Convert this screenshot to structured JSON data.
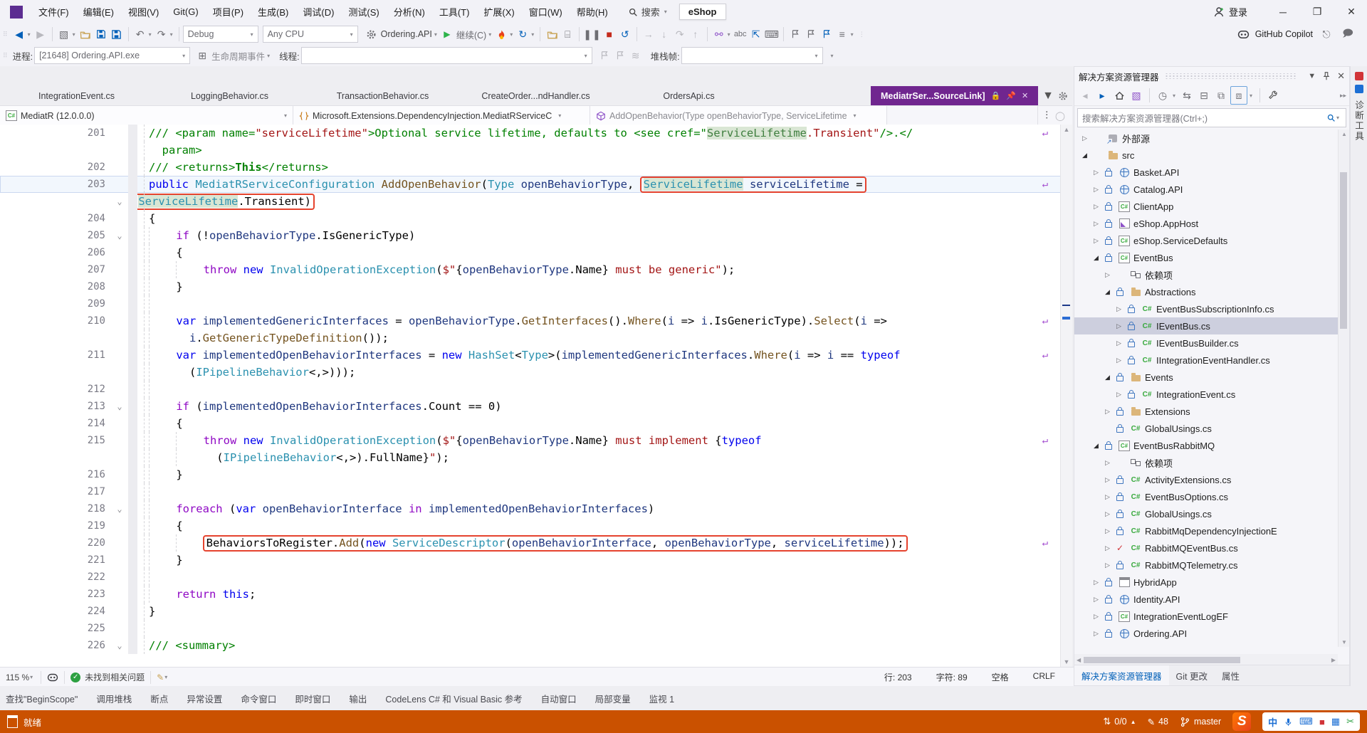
{
  "window": {
    "search_label": "搜索",
    "solution_name": "eShop",
    "sign_in_label": "登录",
    "min_glyph": "─",
    "restore_glyph": "❐",
    "close_glyph": "✕"
  },
  "menu": {
    "items": [
      "文件(F)",
      "编辑(E)",
      "视图(V)",
      "Git(G)",
      "项目(P)",
      "生成(B)",
      "调试(D)",
      "测试(S)",
      "分析(N)",
      "工具(T)",
      "扩展(X)",
      "窗口(W)",
      "帮助(H)"
    ]
  },
  "toolbar": {
    "config_value": "Debug",
    "platform_value": "Any CPU",
    "startup_project": "Ordering.API",
    "continue_label": "继续(C)",
    "copilot_label": "GitHub Copilot"
  },
  "debugbar": {
    "process_label": "进程:",
    "process_value": "[21648] Ordering.API.exe",
    "lifecycle_label": "生命周期事件",
    "thread_label": "线程:",
    "stack_label": "堆栈帧:"
  },
  "tabs": {
    "inactive": [
      "IntegrationEvent.cs",
      "LoggingBehavior.cs",
      "TransactionBehavior.cs",
      "CreateOrder...ndHandler.cs",
      "OrdersApi.cs"
    ],
    "active": "MediatrSer...SourceLink]"
  },
  "breadcrumb": {
    "assembly": "MediatR (12.0.0.0)",
    "type": "Microsoft.Extensions.DependencyInjection.MediatRServiceC",
    "member": "AddOpenBehavior(Type openBehaviorType, ServiceLifetime"
  },
  "editor": {
    "rows": [
      {
        "n": "201",
        "ind": 0,
        "wrap": true,
        "seg": [
          [
            "cm",
            "/// <param name="
          ],
          [
            "s",
            "\"serviceLifetime\""
          ],
          [
            "cm",
            ">Optional service lifetime, defaults to <see cref=\""
          ],
          [
            "hlg",
            "ServiceLifetime"
          ],
          [
            "s",
            ".Transient\""
          ],
          [
            "cm",
            "/>.</"
          ]
        ]
      },
      {
        "n": "",
        "ind": 2,
        "seg": [
          [
            "cm",
            "param>"
          ]
        ]
      },
      {
        "n": "202",
        "ind": 0,
        "seg": [
          [
            "cm",
            "/// <returns>"
          ],
          [
            "cmb",
            "This"
          ],
          [
            "cm",
            "</returns>"
          ]
        ]
      },
      {
        "n": "203",
        "ind": 0,
        "cur": true,
        "wrap": true,
        "seg": [
          [
            "k",
            "public "
          ],
          [
            "t",
            "MediatRServiceConfiguration "
          ],
          [
            "m",
            "AddOpenBehavior"
          ],
          [
            "pl",
            "("
          ],
          [
            "t",
            "Type"
          ],
          [
            "pl",
            " "
          ],
          [
            "p",
            "openBehaviorType"
          ],
          [
            "pl",
            ", "
          ],
          [
            "BOX",
            [
              [
                "hlt",
                "ServiceLifetime"
              ],
              [
                "pl",
                " "
              ],
              [
                "p",
                "serviceLifetime"
              ],
              [
                "pl",
                " ="
              ]
            ]
          ]
        ]
      },
      {
        "n": "",
        "fold": "⌄",
        "ind": -2,
        "seg": [
          [
            "BOX",
            [
              [
                "hlt",
                "ServiceLifetime"
              ],
              [
                "pl",
                ".Transient"
              ],
              [
                "pl",
                ")"
              ]
            ]
          ]
        ]
      },
      {
        "n": "204",
        "ind": 0,
        "seg": [
          [
            "pl",
            "{"
          ]
        ]
      },
      {
        "n": "205",
        "fold": "⌄",
        "ind": 4,
        "seg": [
          [
            "c",
            "if "
          ],
          [
            "pl",
            "(!"
          ],
          [
            "p",
            "openBehaviorType"
          ],
          [
            "pl",
            ".IsGenericType)"
          ]
        ]
      },
      {
        "n": "206",
        "ind": 4,
        "seg": [
          [
            "pl",
            "{"
          ]
        ]
      },
      {
        "n": "207",
        "ind": 8,
        "seg": [
          [
            "c",
            "throw "
          ],
          [
            "k",
            "new "
          ],
          [
            "t",
            "InvalidOperationException"
          ],
          [
            "pl",
            "("
          ],
          [
            "s",
            "$\""
          ],
          [
            "pl",
            "{"
          ],
          [
            "p",
            "openBehaviorType"
          ],
          [
            "pl",
            ".Name}"
          ],
          [
            "s",
            " must be generic\""
          ],
          [
            "pl",
            ");"
          ]
        ]
      },
      {
        "n": "208",
        "ind": 4,
        "seg": [
          [
            "pl",
            "}"
          ]
        ]
      },
      {
        "n": "209",
        "ind": 4,
        "seg": []
      },
      {
        "n": "210",
        "ind": 4,
        "wrap": true,
        "seg": [
          [
            "k",
            "var "
          ],
          [
            "p",
            "implementedGenericInterfaces"
          ],
          [
            "pl",
            " = "
          ],
          [
            "p",
            "openBehaviorType"
          ],
          [
            "pl",
            "."
          ],
          [
            "m",
            "GetInterfaces"
          ],
          [
            "pl",
            "()."
          ],
          [
            "m",
            "Where"
          ],
          [
            "pl",
            "("
          ],
          [
            "p",
            "i"
          ],
          [
            "pl",
            " => "
          ],
          [
            "p",
            "i"
          ],
          [
            "pl",
            ".IsGenericType)."
          ],
          [
            "m",
            "Select"
          ],
          [
            "pl",
            "("
          ],
          [
            "p",
            "i"
          ],
          [
            "pl",
            " =>"
          ]
        ]
      },
      {
        "n": "",
        "ind": 6,
        "seg": [
          [
            "p",
            "i"
          ],
          [
            "pl",
            "."
          ],
          [
            "m",
            "GetGenericTypeDefinition"
          ],
          [
            "pl",
            "());"
          ]
        ]
      },
      {
        "n": "211",
        "ind": 4,
        "wrap": true,
        "seg": [
          [
            "k",
            "var "
          ],
          [
            "p",
            "implementedOpenBehaviorInterfaces"
          ],
          [
            "pl",
            " = "
          ],
          [
            "k",
            "new "
          ],
          [
            "t",
            "HashSet"
          ],
          [
            "pl",
            "<"
          ],
          [
            "t",
            "Type"
          ],
          [
            "pl",
            ">("
          ],
          [
            "p",
            "implementedGenericInterfaces"
          ],
          [
            "pl",
            "."
          ],
          [
            "m",
            "Where"
          ],
          [
            "pl",
            "("
          ],
          [
            "p",
            "i"
          ],
          [
            "pl",
            " => "
          ],
          [
            "p",
            "i"
          ],
          [
            "pl",
            " == "
          ],
          [
            "k",
            "typeof"
          ]
        ]
      },
      {
        "n": "",
        "ind": 6,
        "seg": [
          [
            "pl",
            "("
          ],
          [
            "t",
            "IPipelineBehavior"
          ],
          [
            "pl",
            "<,>)));"
          ]
        ]
      },
      {
        "n": "212",
        "ind": 4,
        "seg": []
      },
      {
        "n": "213",
        "fold": "⌄",
        "ind": 4,
        "seg": [
          [
            "c",
            "if "
          ],
          [
            "pl",
            "("
          ],
          [
            "p",
            "implementedOpenBehaviorInterfaces"
          ],
          [
            "pl",
            ".Count == 0)"
          ]
        ]
      },
      {
        "n": "214",
        "ind": 4,
        "seg": [
          [
            "pl",
            "{"
          ]
        ]
      },
      {
        "n": "215",
        "ind": 8,
        "wrap": true,
        "seg": [
          [
            "c",
            "throw "
          ],
          [
            "k",
            "new "
          ],
          [
            "t",
            "InvalidOperationException"
          ],
          [
            "pl",
            "("
          ],
          [
            "s",
            "$\""
          ],
          [
            "pl",
            "{"
          ],
          [
            "p",
            "openBehaviorType"
          ],
          [
            "pl",
            ".Name}"
          ],
          [
            "s",
            " must implement "
          ],
          [
            "pl",
            "{"
          ],
          [
            "k",
            "typeof"
          ]
        ]
      },
      {
        "n": "",
        "ind": 10,
        "seg": [
          [
            "pl",
            "("
          ],
          [
            "t",
            "IPipelineBehavior"
          ],
          [
            "pl",
            "<,>).FullName}"
          ],
          [
            "s",
            "\""
          ],
          [
            "pl",
            ");"
          ]
        ]
      },
      {
        "n": "216",
        "ind": 4,
        "seg": [
          [
            "pl",
            "}"
          ]
        ]
      },
      {
        "n": "217",
        "ind": 4,
        "seg": []
      },
      {
        "n": "218",
        "fold": "⌄",
        "ind": 4,
        "seg": [
          [
            "c",
            "foreach "
          ],
          [
            "pl",
            "("
          ],
          [
            "k",
            "var "
          ],
          [
            "p",
            "openBehaviorInterface"
          ],
          [
            "pl",
            " "
          ],
          [
            "c",
            "in"
          ],
          [
            "pl",
            " "
          ],
          [
            "p",
            "implementedOpenBehaviorInterfaces"
          ],
          [
            "pl",
            ")"
          ]
        ]
      },
      {
        "n": "219",
        "ind": 4,
        "seg": [
          [
            "pl",
            "{"
          ]
        ]
      },
      {
        "n": "220",
        "ind": 8,
        "wrap": true,
        "seg": [
          [
            "BOX",
            [
              [
                "pl",
                "BehaviorsToRegister."
              ],
              [
                "m",
                "Add"
              ],
              [
                "pl",
                "("
              ],
              [
                "k",
                "new "
              ],
              [
                "t",
                "ServiceDescriptor"
              ],
              [
                "pl",
                "("
              ],
              [
                "p",
                "openBehaviorInterface"
              ],
              [
                "pl",
                ", "
              ],
              [
                "p",
                "openBehaviorType"
              ],
              [
                "pl",
                ", "
              ],
              [
                "p",
                "serviceLifetime"
              ],
              [
                "pl",
                "));"
              ]
            ]
          ]
        ]
      },
      {
        "n": "221",
        "ind": 4,
        "seg": [
          [
            "pl",
            "}"
          ]
        ]
      },
      {
        "n": "222",
        "ind": 4,
        "seg": []
      },
      {
        "n": "223",
        "ind": 4,
        "seg": [
          [
            "c",
            "return "
          ],
          [
            "k",
            "this"
          ],
          [
            "pl",
            ";"
          ]
        ]
      },
      {
        "n": "224",
        "ind": 0,
        "seg": [
          [
            "pl",
            "}"
          ]
        ]
      },
      {
        "n": "225",
        "ind": 0,
        "seg": []
      },
      {
        "n": "226",
        "fold": "⌄",
        "ind": 0,
        "seg": [
          [
            "cm",
            "/// <summary>"
          ]
        ]
      }
    ]
  },
  "edstatus": {
    "zoom": "115 %",
    "health": "未找到相关问题",
    "line": "行: 203",
    "col": "字符: 89",
    "space": "空格",
    "eol": "CRLF"
  },
  "explorer": {
    "title": "解决方案资源管理器",
    "search_placeholder": "搜索解决方案资源管理器(Ctrl+;)",
    "tree": [
      {
        "d": 0,
        "e": "c",
        "i": "ext",
        "t": "外部源"
      },
      {
        "d": 0,
        "e": "e",
        "i": "folder",
        "t": "src"
      },
      {
        "d": 1,
        "e": "c",
        "lk": 1,
        "i": "web",
        "t": "Basket.API"
      },
      {
        "d": 1,
        "e": "c",
        "lk": 1,
        "i": "web",
        "t": "Catalog.API"
      },
      {
        "d": 1,
        "e": "c",
        "lk": 1,
        "i": "csproj",
        "t": "ClientApp"
      },
      {
        "d": 1,
        "e": "c",
        "lk": 1,
        "i": "apph",
        "t": "eShop.AppHost"
      },
      {
        "d": 1,
        "e": "c",
        "lk": 1,
        "i": "csproj",
        "t": "eShop.ServiceDefaults"
      },
      {
        "d": 1,
        "e": "e",
        "lk": 1,
        "i": "csproj",
        "t": "EventBus"
      },
      {
        "d": 2,
        "e": "c",
        "i": "dep",
        "t": "依赖项"
      },
      {
        "d": 2,
        "e": "e",
        "lk": 1,
        "i": "folder",
        "t": "Abstractions"
      },
      {
        "d": 3,
        "e": "c",
        "lk": 1,
        "i": "cs",
        "t": "EventBusSubscriptionInfo.cs"
      },
      {
        "d": 3,
        "e": "c",
        "lk": 1,
        "i": "cs",
        "t": "IEventBus.cs",
        "sel": 1
      },
      {
        "d": 3,
        "e": "c",
        "lk": 1,
        "i": "cs",
        "t": "IEventBusBuilder.cs"
      },
      {
        "d": 3,
        "e": "c",
        "lk": 1,
        "i": "cs",
        "t": "IIntegrationEventHandler.cs"
      },
      {
        "d": 2,
        "e": "e",
        "lk": 1,
        "i": "folder",
        "t": "Events"
      },
      {
        "d": 3,
        "e": "c",
        "lk": 1,
        "i": "cs",
        "t": "IntegrationEvent.cs"
      },
      {
        "d": 2,
        "e": "c",
        "lk": 1,
        "i": "folder",
        "t": "Extensions"
      },
      {
        "d": 2,
        "e": "",
        "lk": 1,
        "i": "cs",
        "t": "GlobalUsings.cs"
      },
      {
        "d": 1,
        "e": "e",
        "lk": 1,
        "i": "csproj",
        "t": "EventBusRabbitMQ"
      },
      {
        "d": 2,
        "e": "c",
        "i": "dep",
        "t": "依赖项"
      },
      {
        "d": 2,
        "e": "c",
        "lk": 1,
        "i": "cs",
        "t": "ActivityExtensions.cs"
      },
      {
        "d": 2,
        "e": "c",
        "lk": 1,
        "i": "cs",
        "t": "EventBusOptions.cs"
      },
      {
        "d": 2,
        "e": "c",
        "lk": 1,
        "i": "cs",
        "t": "GlobalUsings.cs"
      },
      {
        "d": 2,
        "e": "c",
        "lk": 1,
        "i": "cs",
        "t": "RabbitMqDependencyInjectionE"
      },
      {
        "d": 2,
        "e": "c",
        "chk": 1,
        "i": "cs",
        "t": "RabbitMQEventBus.cs"
      },
      {
        "d": 2,
        "e": "c",
        "lk": 1,
        "i": "cs",
        "t": "RabbitMQTelemetry.cs"
      },
      {
        "d": 1,
        "e": "c",
        "lk": 1,
        "i": "win",
        "t": "HybridApp"
      },
      {
        "d": 1,
        "e": "c",
        "lk": 1,
        "i": "web",
        "t": "Identity.API"
      },
      {
        "d": 1,
        "e": "c",
        "lk": 1,
        "i": "csproj",
        "t": "IntegrationEventLogEF"
      },
      {
        "d": 1,
        "e": "c",
        "lk": 1,
        "i": "web",
        "t": "Ordering.API"
      }
    ]
  },
  "panel_tabs": [
    "解决方案资源管理器",
    "Git 更改",
    "属性"
  ],
  "right_strip": {
    "label": "诊断工具"
  },
  "bottom_tabs": [
    "查找\"BeginScope\"",
    "调用堆栈",
    "断点",
    "异常设置",
    "命令窗口",
    "即时窗口",
    "输出",
    "CodeLens C# 和 Visual Basic 参考",
    "自动窗口",
    "局部变量",
    "监视 1"
  ],
  "statusbar": {
    "ready": "就绪",
    "updown": "0/0",
    "pending_edits": "48",
    "branch": "master",
    "sogou": "S",
    "ime_cn": "中"
  },
  "colors": {
    "active_tab": "#70268F",
    "annotation_red": "#E5432E",
    "statusbar_debug_orange": "#CA5100",
    "symbol_highlight": "#D9E6D4",
    "selection_gray": "#CDCFDE"
  }
}
